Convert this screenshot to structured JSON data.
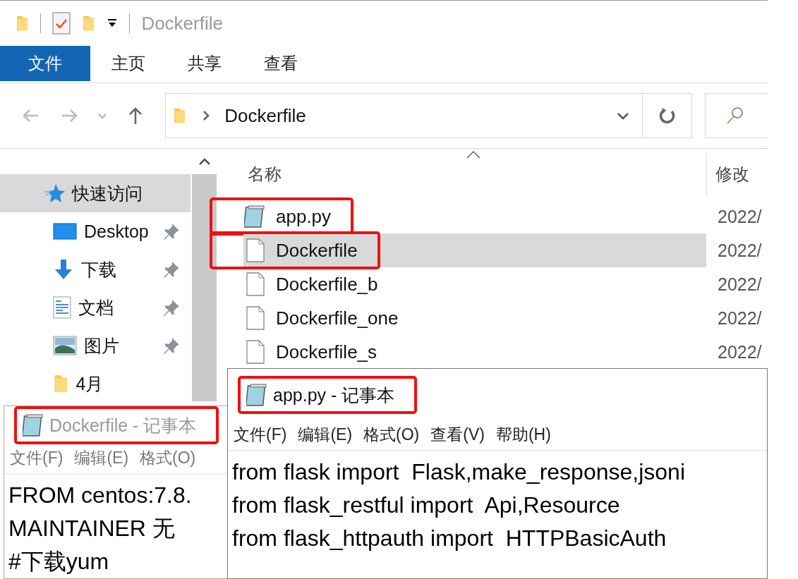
{
  "explorer": {
    "quick_access_toolbar": {
      "title": "Dockerfile"
    },
    "ribbon_tabs": [
      {
        "label": "文件",
        "selected": true
      },
      {
        "label": "主页",
        "selected": false
      },
      {
        "label": "共享",
        "selected": false
      },
      {
        "label": "查看",
        "selected": false
      }
    ],
    "address_bar": {
      "path": "Dockerfile"
    },
    "sidebar": {
      "items": [
        {
          "label": "快速访问",
          "kind": "star",
          "selected": true,
          "children": [
            {
              "label": "Desktop",
              "kind": "desktop",
              "pinned": true,
              "selected": false
            },
            {
              "label": "下载",
              "kind": "download",
              "pinned": true,
              "selected": false
            },
            {
              "label": "文档",
              "kind": "document",
              "pinned": true,
              "selected": false
            },
            {
              "label": "图片",
              "kind": "pictures",
              "pinned": true,
              "selected": false
            },
            {
              "label": "4月",
              "kind": "folder",
              "pinned": false,
              "selected": false
            }
          ]
        }
      ]
    },
    "file_list": {
      "columns": [
        "名称",
        "修改"
      ],
      "rows": [
        {
          "name": "app.py",
          "kind": "notepad",
          "modified": "2022/",
          "selected": false,
          "annotated": true
        },
        {
          "name": "Dockerfile",
          "kind": "file",
          "modified": "2022/",
          "selected": true,
          "annotated": true
        },
        {
          "name": "Dockerfile_b",
          "kind": "file",
          "modified": "2022/",
          "selected": false,
          "annotated": false
        },
        {
          "name": "Dockerfile_one",
          "kind": "file",
          "modified": "2022/",
          "selected": false,
          "annotated": false
        },
        {
          "name": "Dockerfile_s",
          "kind": "file",
          "modified": "2022/",
          "selected": false,
          "annotated": false
        }
      ]
    }
  },
  "notepads": [
    {
      "title": "Dockerfile - 记事本",
      "active": false,
      "annotated": true,
      "menu": [
        "文件(F)",
        "编辑(E)",
        "格式(O)"
      ],
      "lines": [
        "FROM centos:7.8.",
        "MAINTAINER 无",
        "#下载yum"
      ]
    },
    {
      "title": "app.py - 记事本",
      "active": true,
      "annotated": true,
      "menu": [
        "文件(F)",
        "编辑(E)",
        "格式(O)",
        "查看(V)",
        "帮助(H)"
      ],
      "lines": [
        "from flask import  Flask,make_response,jsoni",
        "from flask_restful import  Api,Resource",
        "from flask_httpauth import  HTTPBasicAuth"
      ]
    }
  ]
}
